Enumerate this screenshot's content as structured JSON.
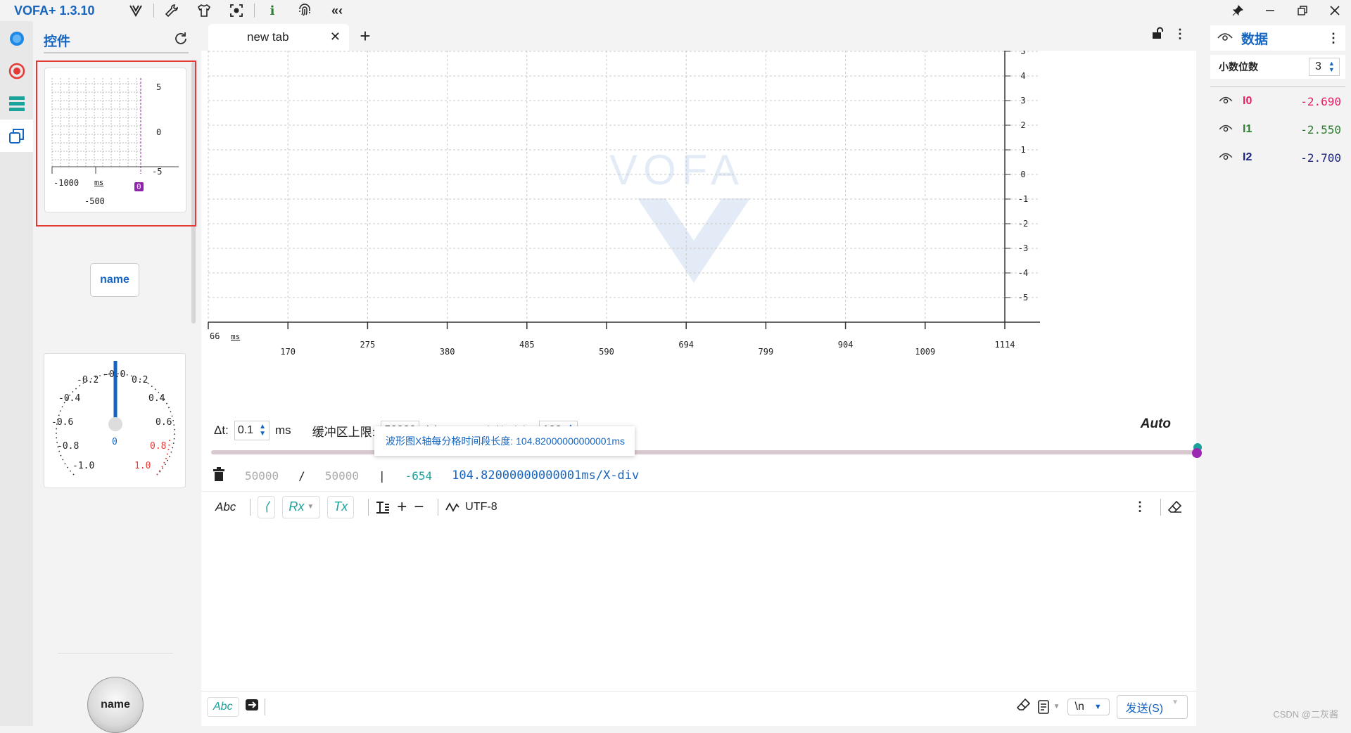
{
  "app": {
    "title": "VOFA+ 1.3.10"
  },
  "controls_panel": {
    "title": "控件",
    "waveform_widget": {
      "y_ticks": [
        "5",
        "0",
        "-5"
      ],
      "x_ticks": [
        "-1000",
        "-500"
      ],
      "x_unit": "ms",
      "marker": "0"
    },
    "button_widget": {
      "label": "name"
    },
    "gauge_widget": {
      "left_labels": [
        "-0.2",
        "-0.4",
        "-0.6",
        "-0.8",
        "-1.0"
      ],
      "right_labels": [
        "0.2",
        "0.4",
        "0.6",
        "0.8",
        "1.0"
      ],
      "top_label": "-0.0",
      "value": "0"
    },
    "round_button": {
      "label": "name"
    }
  },
  "tab": {
    "label": "new tab"
  },
  "chart_data": {
    "type": "line",
    "x_ticks": [
      "66",
      "170",
      "275",
      "380",
      "485",
      "590",
      "694",
      "799",
      "904",
      "1009",
      "1114"
    ],
    "x_unit": "ms",
    "y_ticks": [
      "5",
      "4",
      "3",
      "2",
      "1",
      "0",
      "-1",
      "-2",
      "-3",
      "-4",
      "-5"
    ],
    "ylim": [
      -5,
      5
    ],
    "xlim": [
      66,
      1114
    ],
    "grid": true,
    "series": []
  },
  "controls": {
    "dt_label": "Δt:",
    "dt_value": "0.1",
    "dt_unit": "ms",
    "buffer_label": "缓冲区上限:",
    "buffer_value": "50000",
    "buffer_unit": "/ch",
    "auto_label": "Auto点数对齐:",
    "auto_value": "100",
    "auto_mode": "Auto"
  },
  "tooltip": "波形图X轴每分格时间段长度: 104.82000000000001ms",
  "stats": {
    "count": "50000",
    "slash": "/",
    "total": "50000",
    "pipe": "|",
    "offset": "-654",
    "xdiv": "104.82000000000001ms/X-div"
  },
  "toolbar": {
    "abc": "Abc",
    "rx": "Rx",
    "tx": "Tx",
    "encoding": "UTF-8"
  },
  "send_bar": {
    "abc": "Abc",
    "newline": "\\n",
    "send": "发送(S)"
  },
  "data_panel": {
    "title": "数据",
    "decimals_label": "小数位数",
    "decimals_value": "3",
    "channels": [
      {
        "name": "I0",
        "value": "-2.690",
        "color": "#e91e63"
      },
      {
        "name": "I1",
        "value": "-2.550",
        "color": "#2e7d32"
      },
      {
        "name": "I2",
        "value": "-2.700",
        "color": "#1a237e"
      }
    ]
  },
  "watermark": "CSDN @二灰酱"
}
